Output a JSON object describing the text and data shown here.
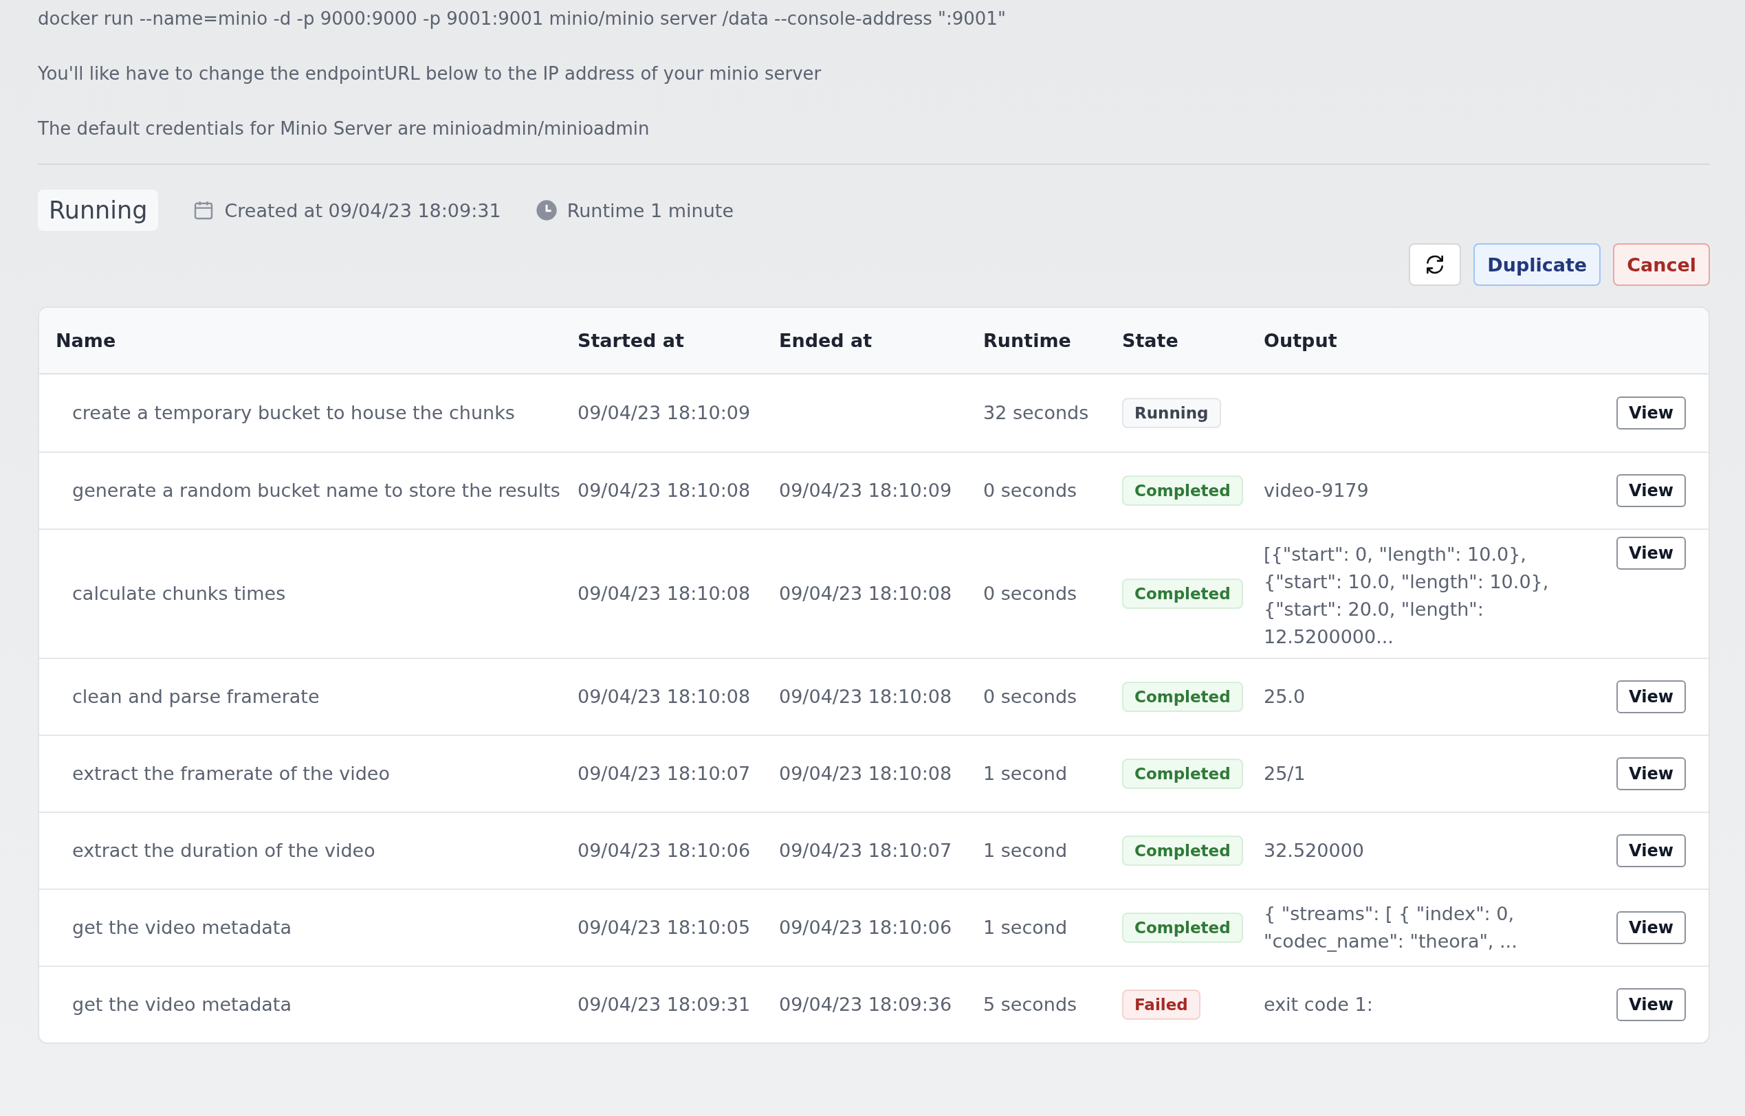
{
  "notes": [
    "docker run --name=minio -d -p 9000:9000 -p 9001:9001 minio/minio server /data --console-address \":9001\"",
    "You'll like have to change the endpointURL below to the IP address of your minio server",
    "The default credentials for Minio Server are minioadmin/minioadmin"
  ],
  "status": {
    "label": "Running",
    "created": "Created at 09/04/23 18:09:31",
    "runtime": "Runtime 1 minute"
  },
  "actions": {
    "duplicate": "Duplicate",
    "cancel": "Cancel"
  },
  "table": {
    "columns": [
      "Name",
      "Started at",
      "Ended at",
      "Runtime",
      "State",
      "Output"
    ],
    "rows": [
      {
        "name": "create a temporary bucket to house the chunks",
        "started": "09/04/23 18:10:09",
        "ended": "",
        "runtime": "32 seconds",
        "state": {
          "label": "Running",
          "kind": "running"
        },
        "output": "",
        "action": "View"
      },
      {
        "name": "generate a random bucket name to store the results",
        "started": "09/04/23 18:10:08",
        "ended": "09/04/23 18:10:09",
        "runtime": "0 seconds",
        "state": {
          "label": "Completed",
          "kind": "completed"
        },
        "output": "video-9179",
        "action": "View"
      },
      {
        "name": "calculate chunks times",
        "started": "09/04/23 18:10:08",
        "ended": "09/04/23 18:10:08",
        "runtime": "0 seconds",
        "state": {
          "label": "Completed",
          "kind": "completed"
        },
        "output": "[{\"start\": 0, \"length\": 10.0}, {\"start\": 10.0, \"length\": 10.0}, {\"start\": 20.0, \"length\": 12.5200000...",
        "action": "View"
      },
      {
        "name": "clean and parse framerate",
        "started": "09/04/23 18:10:08",
        "ended": "09/04/23 18:10:08",
        "runtime": "0 seconds",
        "state": {
          "label": "Completed",
          "kind": "completed"
        },
        "output": "25.0",
        "action": "View"
      },
      {
        "name": "extract the framerate of the video",
        "started": "09/04/23 18:10:07",
        "ended": "09/04/23 18:10:08",
        "runtime": "1 second",
        "state": {
          "label": "Completed",
          "kind": "completed"
        },
        "output": "25/1",
        "action": "View"
      },
      {
        "name": "extract the duration of the video",
        "started": "09/04/23 18:10:06",
        "ended": "09/04/23 18:10:07",
        "runtime": "1 second",
        "state": {
          "label": "Completed",
          "kind": "completed"
        },
        "output": "32.520000",
        "action": "View"
      },
      {
        "name": "get the video metadata",
        "started": "09/04/23 18:10:05",
        "ended": "09/04/23 18:10:06",
        "runtime": "1 second",
        "state": {
          "label": "Completed",
          "kind": "completed"
        },
        "output": "{ \"streams\": [ { \"index\": 0, \"codec_name\": \"theora\", ...",
        "action": "View"
      },
      {
        "name": "get the video metadata",
        "started": "09/04/23 18:09:31",
        "ended": "09/04/23 18:09:36",
        "runtime": "5 seconds",
        "state": {
          "label": "Failed",
          "kind": "failed"
        },
        "output": "exit code 1:",
        "action": "View"
      }
    ]
  }
}
